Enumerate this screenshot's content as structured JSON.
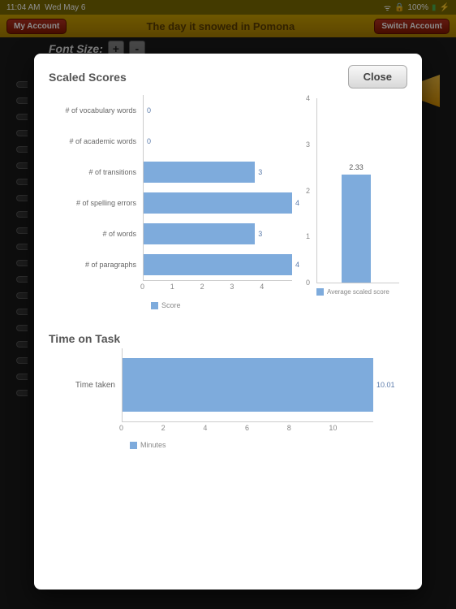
{
  "statusbar": {
    "time": "11:04 AM",
    "date": "Wed May 6",
    "battery": "100%"
  },
  "topbar": {
    "left_btn": "My Account",
    "title": "The day it snowed in Pomona",
    "right_btn": "Switch Account"
  },
  "fontrow": {
    "label": "Font Size:",
    "plus": "+",
    "minus": "-"
  },
  "modal": {
    "close": "Close",
    "scores_title": "Scaled Scores",
    "time_title": "Time on Task"
  },
  "chart_data": [
    {
      "type": "bar",
      "orientation": "horizontal",
      "title": "Scaled Scores",
      "xlabel": "Score",
      "xlim": [
        0,
        4
      ],
      "x_ticks": [
        0,
        1,
        2,
        3,
        4
      ],
      "categories": [
        "# of vocabulary words",
        "# of academic words",
        "# of transitions",
        "# of spelling errors",
        "# of words",
        "# of paragraphs"
      ],
      "values": [
        0,
        0,
        3,
        4,
        3,
        4
      ]
    },
    {
      "type": "bar",
      "orientation": "vertical",
      "title": "Average scaled score",
      "ylim": [
        0,
        4
      ],
      "y_ticks": [
        0,
        1,
        2,
        3,
        4
      ],
      "categories": [
        ""
      ],
      "values": [
        2.33
      ]
    },
    {
      "type": "bar",
      "orientation": "horizontal",
      "title": "Time on Task",
      "xlabel": "Minutes",
      "xlim": [
        0,
        10
      ],
      "x_ticks": [
        0,
        2,
        4,
        6,
        8,
        10
      ],
      "categories": [
        "Time taken"
      ],
      "values": [
        10.01
      ]
    }
  ]
}
